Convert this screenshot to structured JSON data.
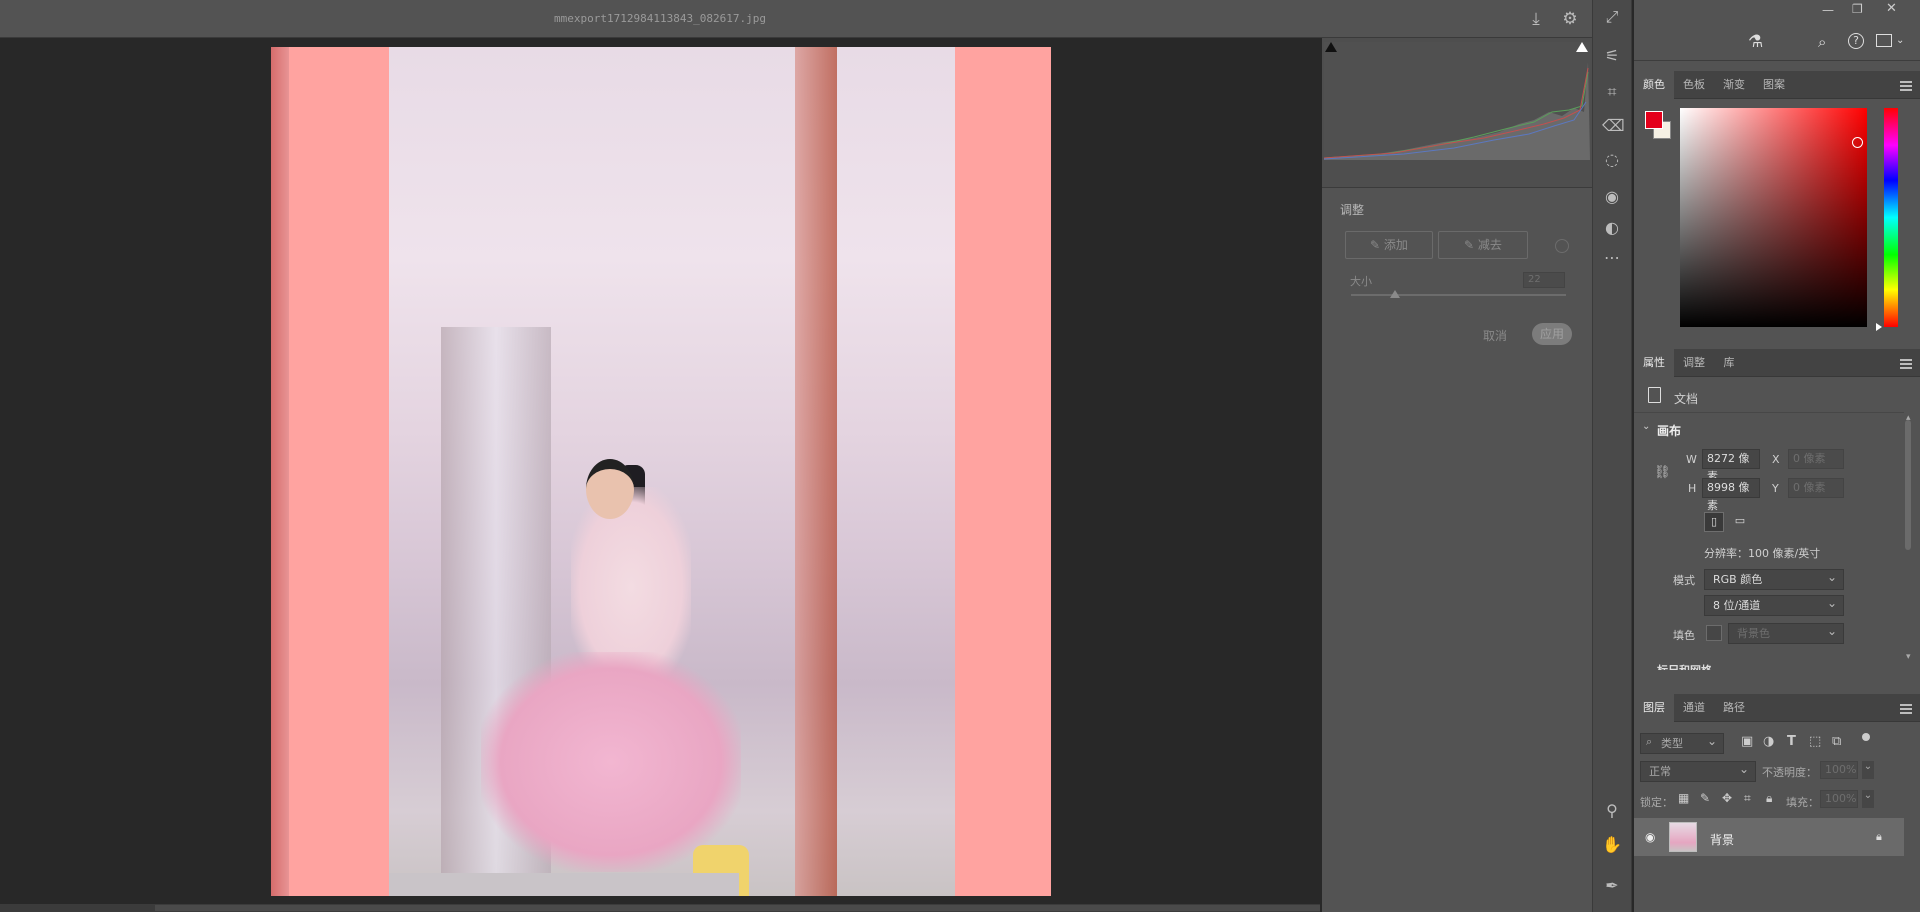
{
  "document": {
    "filename": "mmexport1712984113843_082617.jpg"
  },
  "icons": {
    "download": "download-icon",
    "settings": "gear-icon",
    "expand": "expand-icon",
    "minimize": "minimize-icon",
    "restore": "restore-icon",
    "close": "close-icon",
    "flask": "flask-icon",
    "search": "search-icon",
    "help": "help-icon",
    "workspace": "workspace-icon"
  },
  "adjust": {
    "title": "调整",
    "add_label": "添加",
    "subtract_label": "减去",
    "size_label": "大小",
    "size_value": "22",
    "cancel_label": "取消",
    "apply_label": "应用"
  },
  "color_panel": {
    "tabs": [
      "颜色",
      "色板",
      "渐变",
      "图案"
    ],
    "foreground": "#e4001b",
    "background": "#f5f0e4"
  },
  "properties_panel": {
    "tabs": [
      "属性",
      "调整",
      "库"
    ],
    "doc_label": "文档",
    "canvas_section": "画布",
    "w_label": "W",
    "w_value": "8272 像素",
    "h_label": "H",
    "h_value": "8998 像素",
    "x_label": "X",
    "x_placeholder": "0 像素",
    "y_label": "Y",
    "y_placeholder": "0 像素",
    "resolution": "分辨率：100 像素/英寸",
    "mode_label": "模式",
    "mode_value": "RGB 颜色",
    "bitdepth_value": "8 位/通道",
    "fill_label": "填色",
    "fill_value": "背景色",
    "next_section": "标尺和网格"
  },
  "layers_panel": {
    "tabs": [
      "图层",
      "通道",
      "路径"
    ],
    "filter_placeholder": "类型",
    "blend_mode": "正常",
    "opacity_label": "不透明度：",
    "opacity_value": "100%",
    "lock_label": "锁定：",
    "fill_label": "填充：",
    "fill_value": "100%",
    "layers": [
      {
        "name": "背景",
        "visible": true,
        "locked": true
      }
    ]
  }
}
